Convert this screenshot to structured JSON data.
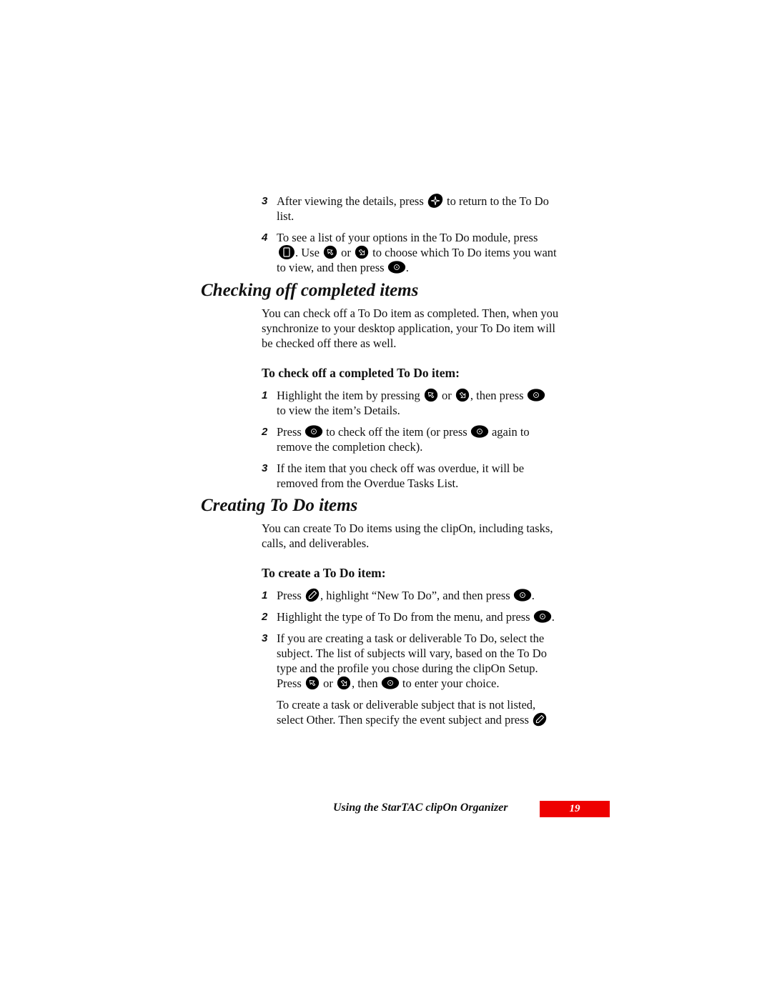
{
  "icons": {
    "back": "diamond-back-key-icon",
    "menu": "menu-key-icon",
    "up": "scroll-up-key-icon",
    "down": "scroll-down-key-icon",
    "select": "select-key-icon",
    "new": "new-pencil-key-icon"
  },
  "top_steps": {
    "step3": {
      "num": "3",
      "l1a": "After viewing the details, press",
      "l1b": "to return to the To Do",
      "l2": "list."
    },
    "step4": {
      "num": "4",
      "l1": "To see a list of your options in the To Do module, press",
      "l2a": ". Use",
      "l2b": "or",
      "l2c": "to choose which To Do items you want",
      "l3a": "to view, and then press",
      "l3b": "."
    }
  },
  "section1": {
    "heading": "Checking off completed items",
    "intro": [
      "You can check off a To Do item as completed. Then, when you",
      "synchronize to your desktop application, your To Do item will",
      "be checked off there as well."
    ],
    "procedure_title": "To check off a completed To Do item:",
    "steps": [
      {
        "num": "1",
        "l1a": "Highlight the item by pressing",
        "l1b": "or",
        "l1c": ", then press",
        "l2": "to view the item’s Details."
      },
      {
        "num": "2",
        "l1a": "Press",
        "l1b": "to check off the item (or press",
        "l1c": "again to",
        "l2": "remove the completion check)."
      },
      {
        "num": "3",
        "l1": "If the item that you check off was overdue, it will be",
        "l2": "removed from the Overdue Tasks List."
      }
    ]
  },
  "section2": {
    "heading": "Creating To Do items",
    "intro": [
      "You can create To Do items using the clipOn, including tasks,",
      "calls, and deliverables."
    ],
    "procedure_title": "To create a To Do item:",
    "steps": [
      {
        "num": "1",
        "l1a": "Press",
        "l1b": ", highlight “New To Do”, and then press",
        "l1c": "."
      },
      {
        "num": "2",
        "l1a": "Highlight the type of To Do from the menu, and press",
        "l1b": "."
      },
      {
        "num": "3",
        "l1": "If you are creating a task or deliverable To Do, select the",
        "l2": "subject. The list of subjects will vary, based on the To Do",
        "l3": "type and the profile you chose during the clipOn Setup.",
        "l4a": "Press",
        "l4b": "or",
        "l4c": ", then",
        "l4d": "to enter your choice."
      }
    ],
    "note": [
      "To create a task or deliverable subject that is not listed,",
      "select Other. Then specify the event subject and press"
    ]
  },
  "footer": {
    "title": "Using the StarTAC clipOn Organizer",
    "page_number": "19",
    "accent_color": "#ee0000"
  }
}
